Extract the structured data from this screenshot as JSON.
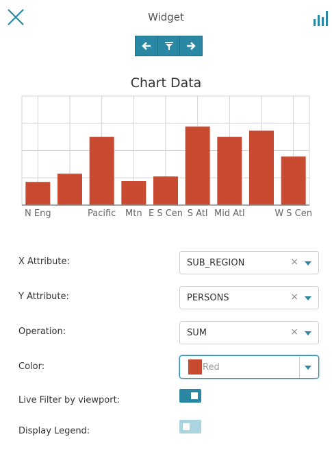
{
  "header": {
    "title": "Widget",
    "close_icon": "close-icon",
    "chart_icon": "bar-chart-icon"
  },
  "toolbar": {
    "buttons": [
      "arrow-left-icon",
      "filter-icon",
      "arrow-right-icon"
    ]
  },
  "chart": {
    "title": "Chart Data"
  },
  "chart_data": {
    "type": "bar",
    "categories": [
      "N Eng",
      "",
      "Pacific",
      "Mtn",
      "E S Cen",
      "S Atl",
      "Mid Atl",
      "",
      "W S Cen"
    ],
    "values": [
      0.85,
      1.15,
      2.5,
      0.88,
      1.05,
      2.88,
      2.5,
      2.73,
      1.78
    ],
    "ylim": [
      0,
      4
    ],
    "bar_color": "#c84a30",
    "grid": true
  },
  "form": {
    "x_attribute": {
      "label": "X Attribute:",
      "value": "SUB_REGION",
      "clear": "×"
    },
    "y_attribute": {
      "label": "Y Attribute:",
      "value": "PERSONS",
      "clear": "×"
    },
    "operation": {
      "label": "Operation:",
      "value": "SUM",
      "clear": "×"
    },
    "color": {
      "label": "Color:",
      "placeholder": "Red",
      "swatch": "#c84a30"
    },
    "live_filter": {
      "label": "Live Filter by viewport:",
      "on": true
    },
    "display_legend": {
      "label": "Display Legend:",
      "on": false
    }
  },
  "colors": {
    "accent": "#2a88a4",
    "accent_light": "#a9d4e0",
    "bar": "#c84a30"
  }
}
